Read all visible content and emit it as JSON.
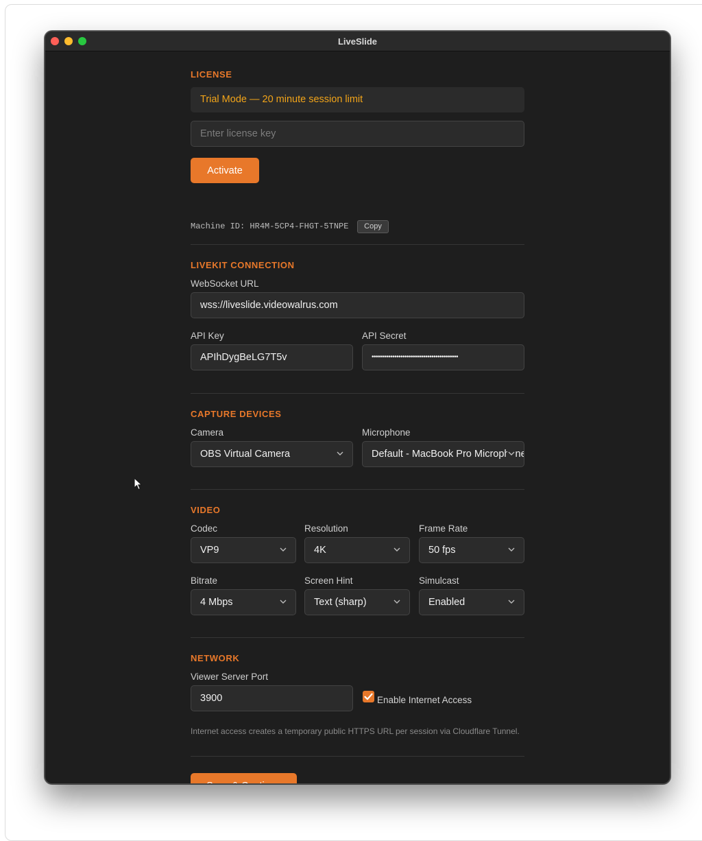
{
  "window": {
    "title": "LiveSlide"
  },
  "license": {
    "section_title": "LICENSE",
    "trial_text": "Trial Mode — 20 minute session limit",
    "key_placeholder": "Enter license key",
    "activate_label": "Activate",
    "machine_id_text": "Machine ID: HR4M-5CP4-FHGT-5TNPE",
    "copy_label": "Copy"
  },
  "livekit": {
    "section_title": "LIVEKIT CONNECTION",
    "ws_label": "WebSocket URL",
    "ws_value": "wss://liveslide.videowalrus.com",
    "api_key_label": "API Key",
    "api_key_value": "APIhDygBeLG7T5v",
    "api_secret_label": "API Secret",
    "api_secret_value": "••••••••••••••••••••••••••••••••••••••••••"
  },
  "capture": {
    "section_title": "CAPTURE DEVICES",
    "camera_label": "Camera",
    "camera_value": "OBS Virtual Camera",
    "mic_label": "Microphone",
    "mic_value": "Default - MacBook Pro Microphone"
  },
  "video": {
    "section_title": "VIDEO",
    "codec_label": "Codec",
    "codec_value": "VP9",
    "resolution_label": "Resolution",
    "resolution_value": "4K",
    "framerate_label": "Frame Rate",
    "framerate_value": "50 fps",
    "bitrate_label": "Bitrate",
    "bitrate_value": "4 Mbps",
    "screenhint_label": "Screen Hint",
    "screenhint_value": "Text (sharp)",
    "simulcast_label": "Simulcast",
    "simulcast_value": "Enabled"
  },
  "network": {
    "section_title": "NETWORK",
    "port_label": "Viewer Server Port",
    "port_value": "3900",
    "internet_label": "Enable Internet Access",
    "internet_checked": true,
    "note": "Internet access creates a temporary public HTTPS URL per session via Cloudflare Tunnel."
  },
  "footer": {
    "save_label": "Save & Continue"
  },
  "colors": {
    "accent": "#e8782a",
    "trial_text": "#f2a419",
    "window_bg": "#1e1e1e",
    "field_bg": "#2b2b2b"
  },
  "icons": {
    "chevron": "chevron-down-icon",
    "check": "checkmark-icon",
    "cursor": "mouse-pointer-icon"
  }
}
